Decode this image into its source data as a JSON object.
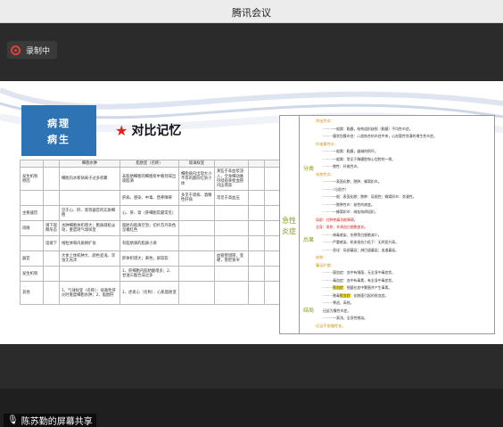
{
  "app": {
    "title": "腾讯会议"
  },
  "recording": {
    "label": "录制中"
  },
  "slide": {
    "topic_line1": "病理",
    "topic_line2": "病生",
    "compare_title": "对比记忆",
    "table": {
      "headers": [
        "",
        "",
        "细胞水肿",
        "脂肪变（名称）",
        "玻璃样变",
        "",
        ""
      ],
      "subheaders": [
        "细胞内",
        "血管壁"
      ],
      "rows": [
        [
          "发生机制原因",
          "",
          "细胞内水和钠离子过多积聚",
          "非脂肪细胞的细胞浆中看到或出现脂滴",
          "细胞质内出现大小不等的圆形红染小体",
          "某些于非血浆浸入，全身细动脉持续痉挛使血管内压增高",
          "",
          ""
        ],
        [
          "",
          "",
          "",
          "肝病、感染、中毒、营养障碍",
          "多见于肾病、酒精性肝病",
          "常见于高血压",
          "",
          ""
        ],
        [
          "主要器官",
          "",
          "见于心、肝、肾等器官的实质细胞",
          "心、肝、肾（肝细胞常最常见）",
          "",
          "",
          "",
          ""
        ],
        [
          "肉眼",
          "镜下观察形态",
          "水肿细胞体积增大；胞质疏松淡染，重度则气球样变",
          "脂肪内脂滴空泡；切片苏丹染色呈橘红色",
          "",
          "",
          "",
          ""
        ],
        [
          "",
          "电镜下",
          "线粒体和内质网扩张",
          "有脂肪滴的脂质小滴",
          "",
          "",
          "",
          ""
        ],
        [
          "器官",
          "",
          "大体上体积肿大、颜色变浅、浑浊无光泽",
          "肝体积增大；黄色；质较软",
          "",
          "血管壁增厚、变硬，管腔狭窄",
          "",
          ""
        ],
        [
          "发生机制",
          "",
          "",
          "1、肝细胞内脂肪酸增多；2、甘油三酯合成过多",
          "",
          "",
          "",
          ""
        ],
        [
          "其他",
          "",
          "1、气球样变（名称）：病毒性肝炎时重度细胞水肿；2、脂肪肝",
          "1、虎斑心（名称）：心肌脂肪变",
          "",
          "",
          "",
          ""
        ]
      ]
    }
  },
  "notes": {
    "cat_left1": "急性",
    "cat_left2": "炎症",
    "cat_mid1": "分类",
    "cat_mid2": "后果",
    "cat_mid3": "结局",
    "lines": [
      {
        "kind": "head",
        "text": "渗出性炎："
      },
      {
        "kind": "line",
        "text": "·········一般属：黏膜，结构组织缺损（黏膜）不均性炎症。"
      },
      {
        "kind": "line",
        "text": "·········膜状包膜炎症：二度结合的炎症中央，心血管性弥漫的增生性炎症。"
      },
      {
        "kind": "head",
        "text": "纤维素性炎："
      },
      {
        "kind": "line",
        "text": "·········一般属：黏膜，器械的损坏。"
      },
      {
        "kind": "line",
        "text": "·········一般属：常见于胸膜腔和心包腔的一侧。"
      },
      {
        "kind": "line",
        "text": "·········脓性：纤维性炎。"
      },
      {
        "kind": "head",
        "text": "化脓性炎："
      },
      {
        "kind": "line",
        "text": "·········一表面化脓、脓肿、蜂窝织炎。"
      },
      {
        "kind": "line",
        "text": "·········（与医疗）"
      },
      {
        "kind": "line",
        "text": "·········一般：表面化脓；脓肿：局限性；蜂窝织炎：弥漫性。"
      },
      {
        "kind": "line",
        "text": "·········一脓肿性炎：核性的病变。"
      },
      {
        "kind": "line",
        "text": "·········一蜂窝织炎：疏松结缔组织。"
      },
      {
        "kind": "red",
        "text": "局部：红肿热痛功能障碍。"
      },
      {
        "kind": "red",
        "text": "全身：发热、外周血白细胞变化。"
      },
      {
        "kind": "line",
        "text": "·········病毒感染、伤寒等白细胞减少。"
      },
      {
        "kind": "line",
        "text": "·········严重感染、机体抵抗力低下：无明显升高。"
      },
      {
        "kind": "line",
        "text": "·········恶化：局部蔓延；淋巴道蔓延；血道蔓延。"
      },
      {
        "kind": "head",
        "text": "痊愈："
      },
      {
        "kind": "head",
        "text": "蔓延扩散："
      },
      {
        "kind": "line",
        "text": "·········菌血症：血中有细菌，无全身中毒症状。"
      },
      {
        "kind": "line",
        "text": "·········毒血症：血中有毒素，有全身中毒症状。"
      },
      {
        "kind": "line",
        "text": "·········败血症：细菌在血中繁殖并产生毒素。"
      },
      {
        "kind": "line",
        "text": "·········脓毒败血症：化脓菌引起的败血症。"
      },
      {
        "kind": "line",
        "text": "·········寒战、高热。"
      },
      {
        "kind": "line",
        "text": "迁延为慢性炎症。"
      },
      {
        "kind": "line",
        "text": "·········一表浅、全身性感染。"
      },
      {
        "kind": "head",
        "text": "迁延不愈慢性化。"
      }
    ],
    "highlight": "败血症"
  },
  "sharing": {
    "label": "陈苏勤的屏幕共享"
  }
}
